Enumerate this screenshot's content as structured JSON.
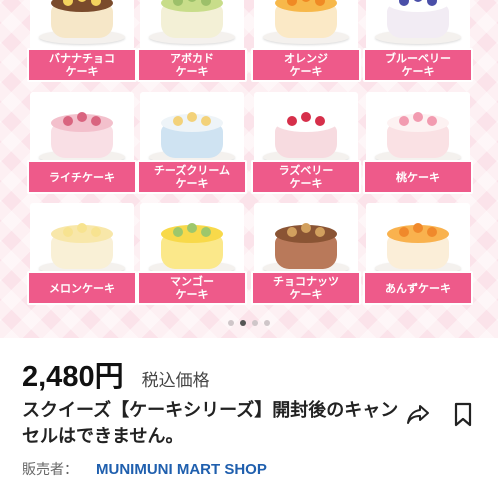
{
  "carousel": {
    "cakes": [
      {
        "label": "バナナチョコ\nケーキ",
        "colors": {
          "body": "#f6e7c8",
          "top": "#7a4b2c",
          "accent": "#f4d35e"
        }
      },
      {
        "label": "アボカド\nケーキ",
        "colors": {
          "body": "#f3f0d6",
          "top": "#c8dd8a",
          "accent": "#9cc06a"
        }
      },
      {
        "label": "オレンジ\nケーキ",
        "colors": {
          "body": "#fbe9c6",
          "top": "#f7b84a",
          "accent": "#f08a24"
        }
      },
      {
        "label": "ブルーベリー\nケーキ",
        "colors": {
          "body": "#f2ecf4",
          "top": "#ffffff",
          "accent": "#4a4fa8"
        }
      },
      {
        "label": "ライチケーキ",
        "colors": {
          "body": "#f9dfe5",
          "top": "#f3c0cc",
          "accent": "#d9647f"
        }
      },
      {
        "label": "チーズクリーム\nケーキ",
        "colors": {
          "body": "#cfe3f2",
          "top": "#eef4f8",
          "accent": "#f3d27a"
        }
      },
      {
        "label": "ラズベリー\nケーキ",
        "colors": {
          "body": "#f7dbe0",
          "top": "#ffffff",
          "accent": "#d62f4a"
        }
      },
      {
        "label": "桃ケーキ",
        "colors": {
          "body": "#fae1e4",
          "top": "#fdf2f2",
          "accent": "#f29bb0"
        }
      },
      {
        "label": "メロンケーキ",
        "colors": {
          "body": "#f9f0d6",
          "top": "#f8e7a9",
          "accent": "#f7e390"
        }
      },
      {
        "label": "マンゴー\nケーキ",
        "colors": {
          "body": "#fbe88a",
          "top": "#f8d94a",
          "accent": "#9dc76b"
        }
      },
      {
        "label": "チョコナッツ\nケーキ",
        "colors": {
          "body": "#b9795a",
          "top": "#8a5434",
          "accent": "#d2a05e"
        }
      },
      {
        "label": "あんずケーキ",
        "colors": {
          "body": "#fbeed8",
          "top": "#f9b24e",
          "accent": "#f0892b"
        }
      }
    ],
    "page_indicator": {
      "total": 4,
      "active": 1
    }
  },
  "product": {
    "price": "2,480円",
    "tax_label": "税込価格",
    "title": "スクイーズ【ケーキシリーズ】開封後のキャンセルはできません。",
    "seller_label": "販売者：",
    "seller_name": "MUNIMUNI MART SHOP"
  },
  "icons": {
    "share": "share-icon",
    "bookmark": "bookmark-icon"
  },
  "colors": {
    "label_bg": "#ee5a8a",
    "seller_link": "#1f5fae",
    "banner_bg": "#fbe3ea"
  }
}
